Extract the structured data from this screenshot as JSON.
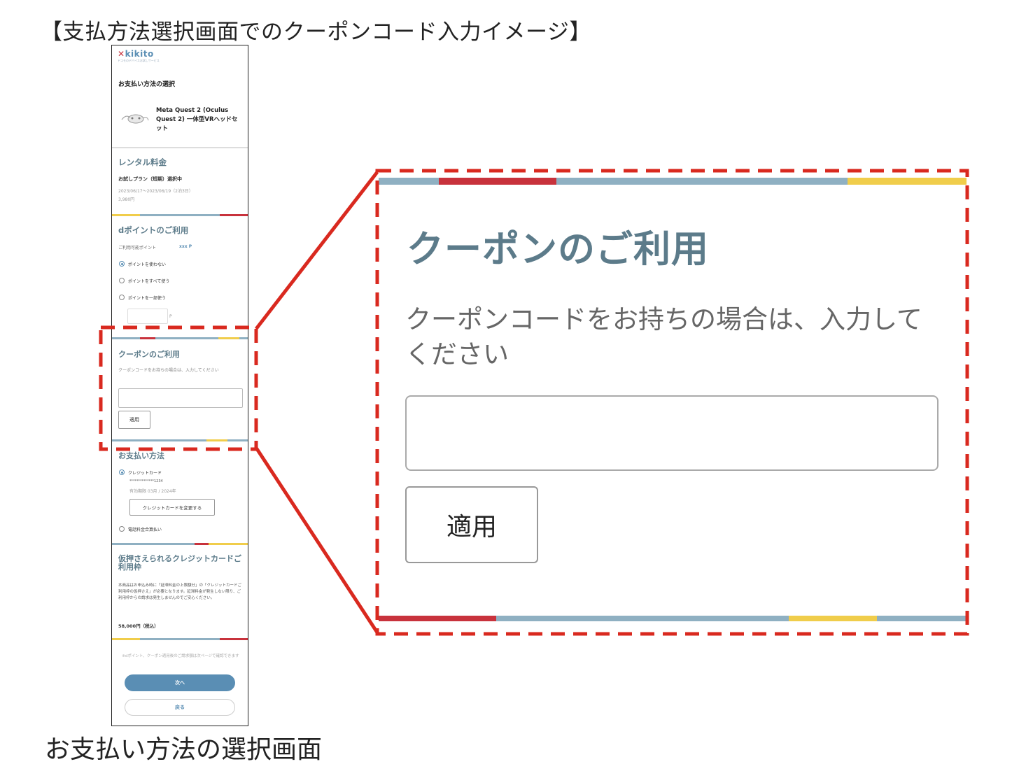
{
  "heading": "【支払方法選択画面でのクーポンコード入力イメージ】",
  "caption": "お支払い方法の選択画面",
  "colors": {
    "accent_red": "#c8323c",
    "blue_gray": "#8fb0c2",
    "yellow": "#f0cd4b",
    "heading_teal": "#5c7b8a",
    "callout_red": "#d9291f"
  },
  "phone": {
    "logo": "kikito",
    "logo_sub": "ドコモのデバイスお試しサービス",
    "page_title": "お支払い方法の選択",
    "product_name": "Meta Quest 2 (Oculus Quest 2) 一体型VRヘッドセット",
    "rental": {
      "title": "レンタル料金",
      "plan": "お試しプラン（短期）選択中",
      "period": "2023/06/17〜2023/06/19（2泊3日）",
      "price": "3,980円"
    },
    "points": {
      "title": "dポイントのご利用",
      "available_label": "ご利用可能ポイント",
      "available_value": "xxx P",
      "options": [
        "ポイントを使わない",
        "ポイントをすべて使う",
        "ポイントを一部使う"
      ],
      "unit": "P"
    },
    "coupon": {
      "title": "クーポンのご利用",
      "desc": "クーポンコードをお持ちの場合は、入力してください",
      "apply": "適用"
    },
    "payment": {
      "title": "お支払い方法",
      "card_option": "クレジットカード",
      "card_number": "**************1234",
      "expiry": "有効期限 03月 / 2024年",
      "change_card": "クレジットカードを変更する",
      "phone_bill": "電話料金合算払い"
    },
    "hold": {
      "title": "仮押さえられるクレジットカードご利用枠",
      "body": "本商品はお申込み時に「延滞料金の上限額分」の「クレジットカードご利用枠の仮押さえ」が必要となります。延滞料金が発生しない限り、ご利用枠からの請求は発生しませんのでご安心ください。",
      "amount": "58,000円（税込）"
    },
    "note": "※dポイント、クーポン適用後のご請求額は次ページで確認できます",
    "next": "次へ",
    "back": "戻る"
  },
  "zoom": {
    "title": "クーポンのご利用",
    "desc": "クーポンコードをお持ちの場合は、入力してください",
    "input_value": "",
    "apply": "適用"
  }
}
